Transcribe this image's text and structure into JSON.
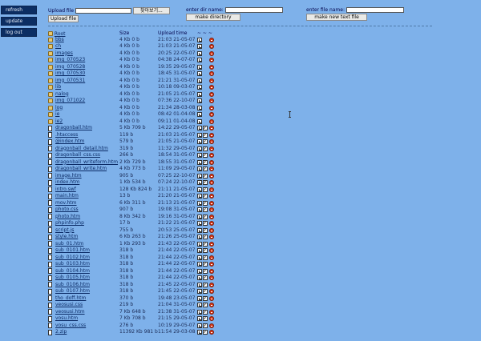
{
  "sidebar": {
    "buttons": [
      "refresh",
      "update",
      "log out"
    ]
  },
  "upload": {
    "label": "Upload file",
    "browse": "찾아보기...",
    "submit": "Upload file"
  },
  "dir": {
    "label": "enter dir name:",
    "submit": "make directory"
  },
  "newfile": {
    "label": "enter file name:",
    "submit": "make new text file"
  },
  "table": {
    "col_name": "Root",
    "col_size": "Size",
    "col_time": "Upload time",
    "col_actions": "~ ~ ~"
  },
  "rows": [
    {
      "type": "folder",
      "name": "bbs",
      "size": "4 Kb 0 b",
      "time": "21:03 21-05-07"
    },
    {
      "type": "folder",
      "name": "ch",
      "size": "4 Kb 0 b",
      "time": "21:03 21-05-07"
    },
    {
      "type": "folder",
      "name": "images",
      "size": "4 Kb 0 b",
      "time": "20:25 22-05-07"
    },
    {
      "type": "folder",
      "name": "img_070523",
      "size": "4 Kb 0 b",
      "time": "04:38 24-07-07"
    },
    {
      "type": "folder",
      "name": "img_070528",
      "size": "4 Kb 0 b",
      "time": "19:35 29-05-07"
    },
    {
      "type": "folder",
      "name": "img_070530",
      "size": "4 Kb 0 b",
      "time": "18:45 31-05-07"
    },
    {
      "type": "folder",
      "name": "img_070531",
      "size": "4 Kb 0 b",
      "time": "21:21 31-05-07"
    },
    {
      "type": "folder",
      "name": "lib",
      "size": "4 Kb 0 b",
      "time": "10:18 09-03-07"
    },
    {
      "type": "folder",
      "name": "nalog",
      "size": "4 Kb 0 b",
      "time": "21:05 21-05-07"
    },
    {
      "type": "folder",
      "name": "img_071022",
      "size": "4 Kb 0 b",
      "time": "07:36 22-10-07"
    },
    {
      "type": "folder",
      "name": "log",
      "size": "4 Kb 0 b",
      "time": "21:34 28-03-08"
    },
    {
      "type": "folder",
      "name": "ie",
      "size": "4 Kb 0 b",
      "time": "08:42 01-04-08"
    },
    {
      "type": "folder",
      "name": "ie2",
      "size": "4 Kb 0 b",
      "time": "09:11 01-04-08"
    },
    {
      "type": "file",
      "name": "dragonball.htm",
      "size": "5 Kb 709 b",
      "time": "14:22 29-05-07"
    },
    {
      "type": "file",
      "name": ".htaccess",
      "size": "119 b",
      "time": "21:03 21-05-07"
    },
    {
      "type": "file",
      "name": "@index.htm",
      "size": "579 b",
      "time": "21:05 21-05-07"
    },
    {
      "type": "file",
      "name": "dragonball_detail.htm",
      "size": "319 b",
      "time": "11:32 29-05-07"
    },
    {
      "type": "file",
      "name": "dragonball_css.css",
      "size": "266 b",
      "time": "18:54 31-05-07"
    },
    {
      "type": "file",
      "name": "dragonball_writeform.htm",
      "size": "2 Kb 729 b",
      "time": "18:55 31-05-07"
    },
    {
      "type": "file",
      "name": "dragonball_write.htm",
      "size": "4 Kb 773 b",
      "time": "11:09 29-05-07"
    },
    {
      "type": "file",
      "name": "image.htm",
      "size": "905 b",
      "time": "07:25 22-10-07"
    },
    {
      "type": "file",
      "name": "index.htm",
      "size": "1 Kb 534 b",
      "time": "07:24 22-10-07"
    },
    {
      "type": "file",
      "name": "intro.swf",
      "size": "128 Kb 824 b",
      "time": "21:11 21-05-07"
    },
    {
      "type": "file",
      "name": "main.htm",
      "size": "13 b",
      "time": "21:20 21-05-07"
    },
    {
      "type": "file",
      "name": "mov.htm",
      "size": "6 Kb 311 b",
      "time": "21:13 21-05-07"
    },
    {
      "type": "file",
      "name": "photo.css",
      "size": "907 b",
      "time": "19:08 31-05-07"
    },
    {
      "type": "file",
      "name": "photo.htm",
      "size": "8 Kb 342 b",
      "time": "19:16 31-05-07"
    },
    {
      "type": "file",
      "name": "phpinfo.php",
      "size": "17 b",
      "time": "21:22 21-05-07"
    },
    {
      "type": "file",
      "name": "script.js",
      "size": "755 b",
      "time": "20:53 25-05-07"
    },
    {
      "type": "file",
      "name": "style.htm",
      "size": "6 Kb 263 b",
      "time": "21:26 25-05-07"
    },
    {
      "type": "file",
      "name": "sub_01.htm",
      "size": "1 Kb 293 b",
      "time": "21:43 22-05-07"
    },
    {
      "type": "file",
      "name": "sub_0101.htm",
      "size": "318 b",
      "time": "21:44 22-05-07"
    },
    {
      "type": "file",
      "name": "sub_0102.htm",
      "size": "318 b",
      "time": "21:44 22-05-07"
    },
    {
      "type": "file",
      "name": "sub_0103.htm",
      "size": "318 b",
      "time": "21:44 22-05-07"
    },
    {
      "type": "file",
      "name": "sub_0104.htm",
      "size": "318 b",
      "time": "21:44 22-05-07"
    },
    {
      "type": "file",
      "name": "sub_0105.htm",
      "size": "318 b",
      "time": "21:44 22-05-07"
    },
    {
      "type": "file",
      "name": "sub_0106.htm",
      "size": "318 b",
      "time": "21:45 22-05-07"
    },
    {
      "type": "file",
      "name": "sub_0107.htm",
      "size": "318 b",
      "time": "21:45 22-05-07"
    },
    {
      "type": "file",
      "name": "tho_doff.htm",
      "size": "370 b",
      "time": "19:48 23-05-07"
    },
    {
      "type": "file",
      "name": "veosusi.css",
      "size": "219 b",
      "time": "21:04 31-05-07"
    },
    {
      "type": "file",
      "name": "veosusi.htm",
      "size": "7 Kb 648 b",
      "time": "21:38 31-05-07"
    },
    {
      "type": "file",
      "name": "vosu.htm",
      "size": "7 Kb 708 b",
      "time": "21:15 29-05-07"
    },
    {
      "type": "file",
      "name": "vosu_css.css",
      "size": "276 b",
      "time": "10:19 29-05-07"
    },
    {
      "type": "file",
      "name": "2.zip",
      "size": "11392 Kb 981 b",
      "time": "11:54 29-03-08"
    }
  ]
}
